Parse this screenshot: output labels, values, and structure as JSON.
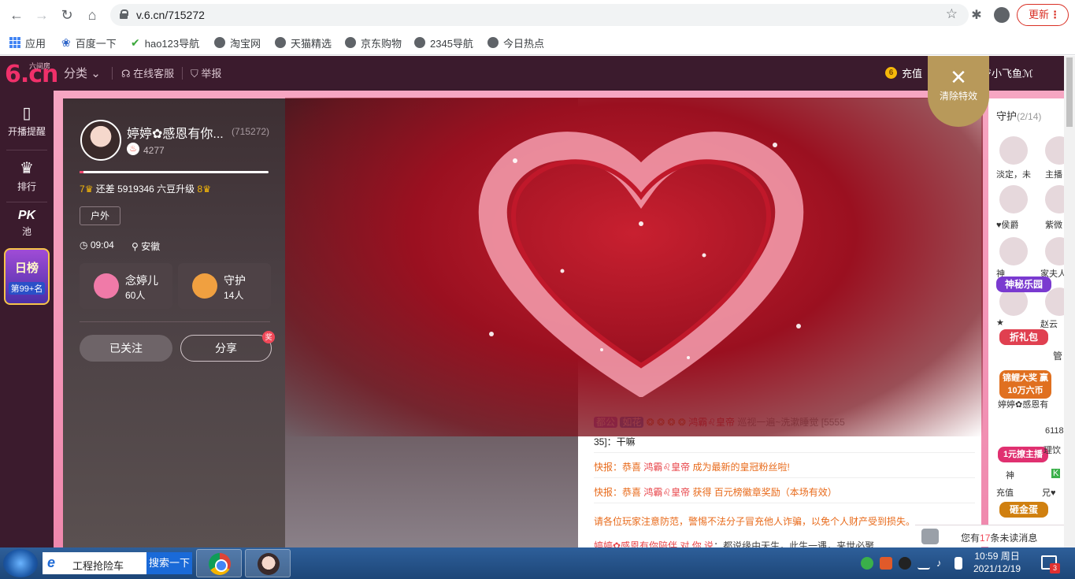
{
  "browser": {
    "url": "v.6.cn/715272",
    "update_label": "更新",
    "bookmarks": [
      {
        "label": "应用",
        "icon": "apps-grid-icon"
      },
      {
        "label": "百度一下",
        "icon": "baidu-paw-icon"
      },
      {
        "label": "hao123导航",
        "icon": "hao123-icon"
      },
      {
        "label": "淘宝网",
        "icon": "globe-icon"
      },
      {
        "label": "天猫精选",
        "icon": "globe-icon"
      },
      {
        "label": "京东购物",
        "icon": "globe-icon"
      },
      {
        "label": "2345导航",
        "icon": "globe-icon"
      },
      {
        "label": "今日热点",
        "icon": "globe-icon"
      }
    ]
  },
  "site": {
    "logo_text": "6.cn",
    "logo_sub": "六间房",
    "topbar": {
      "category": "分类",
      "service": "在线客服",
      "report": "举报",
      "recharge": "充值",
      "coin_glyph": "6",
      "username": "ジ小飞鱼ℳ"
    },
    "clear_effects": "清除特效",
    "leftnav": [
      {
        "label": "开播提醒",
        "icon": "phone-icon"
      },
      {
        "label": "排行",
        "icon": "crown-icon"
      },
      {
        "label": "池",
        "icon": "pk-icon",
        "glyph": "PK"
      }
    ],
    "rank_badge": {
      "title": "日榜",
      "sub": "第99+名"
    },
    "anchor": {
      "name": "婷婷✿感恩有你...",
      "id": "(715272)",
      "fire": "4277",
      "level_progress": 0.02,
      "upgrade_text": "还差 5919346 六豆升级",
      "level_from": "7",
      "level_to": "8",
      "tag": "户外",
      "time": "09:04",
      "location": "安徽"
    },
    "cards": [
      {
        "name": "念婷儿",
        "count": "60人",
        "icon": "fan-club-icon",
        "color": "#f07aa8"
      },
      {
        "name": "守护",
        "count": "14人",
        "icon": "guard-shield-icon",
        "color": "#f0a040"
      }
    ],
    "follow_label": "已关注",
    "share_label": "分享",
    "share_badge": "奖",
    "chat": [
      {
        "kind": "user",
        "prefix": "都公",
        "badge2": "如花",
        "user": "鸿霸♌皇帝",
        "text": "巡视一遍~洗漱睡觉 [5555"
      },
      {
        "kind": "cont",
        "text": "35]：干嘛"
      },
      {
        "kind": "news",
        "prefix": "快报：恭喜 ",
        "user": "鸿霸♌皇帝",
        "text": " 成为最新的皇冠粉丝啦!"
      },
      {
        "kind": "news",
        "prefix": "快报：恭喜 ",
        "user": "鸿霸♌皇帝",
        "text": " 获得 百元榜徽章奖励（本场有效）"
      },
      {
        "kind": "notice",
        "text": "请各位玩家注意防范，警惕不法分子冒充他人诈骗，以免个人财产受到损失。"
      },
      {
        "kind": "user",
        "user": "婷婷✿感恩有你陪伴 对 你 说",
        "text": "：都说缘由天生，此生一遇，来世必聚"
      }
    ],
    "guard_panel": {
      "title": "守护",
      "count": "(2/14)",
      "guards": [
        {
          "name": "淡定，未"
        },
        {
          "name": "主播"
        },
        {
          "name": "♥侯爵"
        },
        {
          "name": "紫微"
        },
        {
          "name": "神"
        },
        {
          "name": "家夫人"
        },
        {
          "name": "★"
        },
        {
          "name": "赵云"
        }
      ],
      "promos": [
        {
          "label": "神秘乐园",
          "color": "#7a3ad0"
        },
        {
          "label": "折礼包",
          "color": "#e04050"
        },
        {
          "label": "锦鲤大奖 赢10万六币",
          "color": "#e07020"
        },
        {
          "label": "1元撩主播",
          "color": "#e03070"
        },
        {
          "label": "砸金蛋",
          "color": "#d08010"
        }
      ],
      "side_texts": [
        "管",
        "婷婷✿感恩有",
        "6118",
        "理饮",
        "神",
        "充值",
        "兄♥",
        "K"
      ]
    },
    "unread": {
      "prefix": "您有",
      "count": "17",
      "suffix": "条未读消息"
    }
  },
  "taskbar": {
    "search_text": "工程抢险车",
    "search_go": "搜索一下",
    "time": "10:59 周日",
    "date": "2021/12/19",
    "notif_count": "3"
  }
}
